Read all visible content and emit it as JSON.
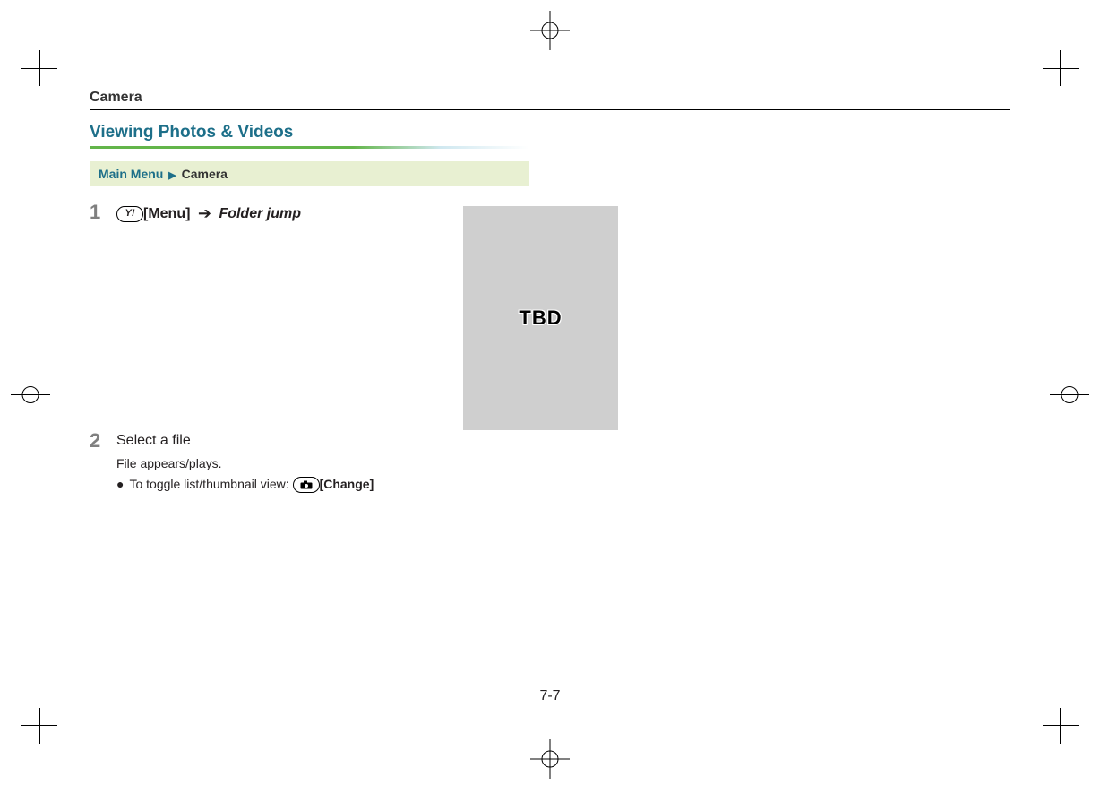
{
  "header": {
    "section": "Camera"
  },
  "title": "Viewing Photos & Videos",
  "breadcrumb": {
    "main": "Main Menu",
    "separator": "▶",
    "item": "Camera"
  },
  "steps": [
    {
      "num": "1",
      "key_glyph": "Y!",
      "key_label": "[Menu]",
      "arrow": "➔",
      "action": "Folder jump"
    },
    {
      "num": "2",
      "body": "Select a file",
      "sub": "File appears/plays.",
      "bullet": "●",
      "toggle_text": "To toggle list/thumbnail view: ",
      "toggle_key_label": "[Change]"
    }
  ],
  "placeholder": {
    "text": "TBD"
  },
  "page_number": "7-7"
}
